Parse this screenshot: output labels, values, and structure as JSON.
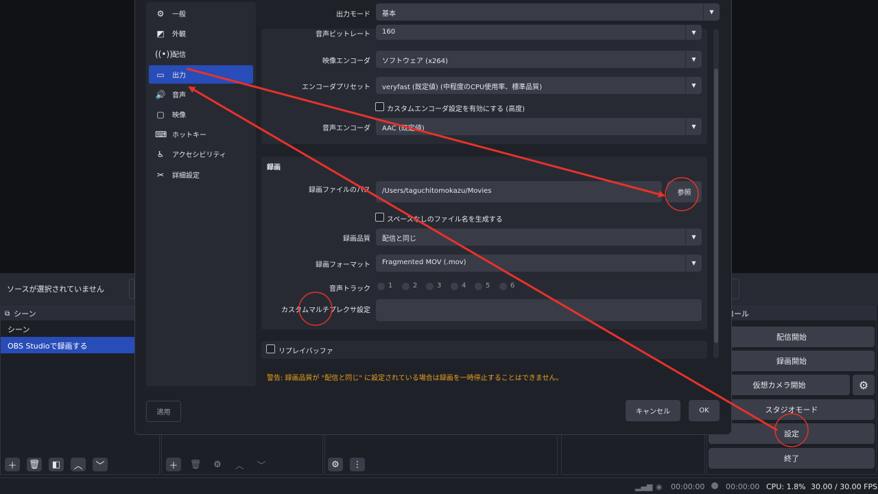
{
  "main": {
    "source_status": "ソースが選択されていません",
    "scenes_title": "シーン",
    "scenes": [
      "シーン",
      "OBS Studioで録画する"
    ],
    "controls_title": "コントロール",
    "controls_title_visible": "ントロール",
    "controls": {
      "start_stream": "配信開始",
      "start_record": "録画開始",
      "virtual_cam": "仮想カメラ開始",
      "studio_mode": "スタジオモード",
      "settings": "設定",
      "exit": "終了"
    }
  },
  "status": {
    "time1": "00:00:00",
    "time2": "00:00:00",
    "cpu": "CPU: 1.8%",
    "fps": "30.00 / 30.00 FPS"
  },
  "settings": {
    "nav": [
      {
        "label": "一般",
        "icon": "gear-icon"
      },
      {
        "label": "外観",
        "icon": "appearance-icon"
      },
      {
        "label": "配信",
        "icon": "broadcast-icon"
      },
      {
        "label": "出力",
        "icon": "output-icon"
      },
      {
        "label": "音声",
        "icon": "speaker-icon"
      },
      {
        "label": "映像",
        "icon": "monitor-icon"
      },
      {
        "label": "ホットキー",
        "icon": "keyboard-icon"
      },
      {
        "label": "アクセシビリティ",
        "icon": "accessibility-icon"
      },
      {
        "label": "詳細設定",
        "icon": "tools-icon"
      }
    ],
    "output_mode_label": "出力モード",
    "output_mode": "基本",
    "streaming": {
      "audio_bitrate_label": "音声ビットレート",
      "audio_bitrate": "160",
      "video_encoder_label": "映像エンコーダ",
      "video_encoder": "ソフトウェア (x264)",
      "preset_label": "エンコーダプリセット",
      "preset": "veryfast (既定値) (中程度のCPU使用率、標準品質)",
      "custom_encoder": "カスタムエンコーダ設定を有効にする (高度)",
      "audio_encoder_label": "音声エンコーダ",
      "audio_encoder": "AAC (既定値)"
    },
    "recording": {
      "title": "録画",
      "path_label": "録画ファイルのパス",
      "path": "/Users/taguchitomokazu/Movies",
      "browse": "参照",
      "no_space": "スペースなしのファイル名を生成する",
      "quality_label": "録画品質",
      "quality": "配信と同じ",
      "format_label": "録画フォーマット",
      "format": "Fragmented MOV (.mov)",
      "tracks_label": "音声トラック",
      "tracks": [
        "1",
        "2",
        "3",
        "4",
        "5",
        "6"
      ],
      "muxer_label": "カスタムマルチプレクサ設定",
      "muxer": ""
    },
    "replay_buffer": "リプレイバッファ",
    "warning": "警告: 録画品質が \"配信と同じ\" に設定されている場合は録画を一時停止することはできません。",
    "apply": "適用",
    "cancel": "キャンセル",
    "ok": "OK"
  },
  "colors": {
    "accent": "#284cb8",
    "annotation": "#e8322b",
    "warning": "#e8a21c"
  }
}
